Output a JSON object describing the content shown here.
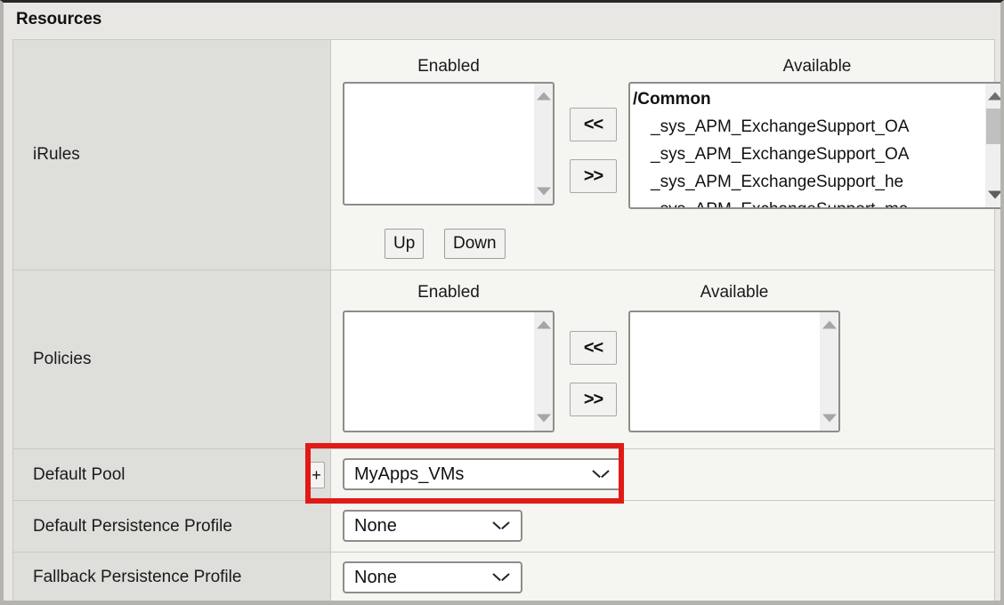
{
  "panel": {
    "title": "Resources"
  },
  "rows": [
    {
      "label": "iRules",
      "enabled_title": "Enabled",
      "available_title": "Available",
      "enabled_items": [],
      "available_items": [
        "/Common",
        "_sys_APM_ExchangeSupport_OA",
        "_sys_APM_ExchangeSupport_OA",
        "_sys_APM_ExchangeSupport_he",
        "_sys_APM_ExchangeSupport_ma"
      ],
      "move_left_label": "<<",
      "move_right_label": ">>",
      "up_label": "Up",
      "down_label": "Down"
    },
    {
      "label": "Policies",
      "enabled_title": "Enabled",
      "available_title": "Available",
      "enabled_items": [],
      "available_items": [],
      "move_left_label": "<<",
      "move_right_label": ">>"
    }
  ],
  "default_pool": {
    "label": "Default Pool",
    "add_button_label": "+",
    "value": "MyApps_VMs"
  },
  "default_persistence": {
    "label": "Default Persistence Profile",
    "value": "None"
  },
  "fallback_persistence": {
    "label": "Fallback Persistence Profile",
    "value": "None"
  },
  "colors": {
    "highlight": "#e01b16",
    "label_cell_bg": "#dededa",
    "panel_bg": "#e8e7e3"
  }
}
